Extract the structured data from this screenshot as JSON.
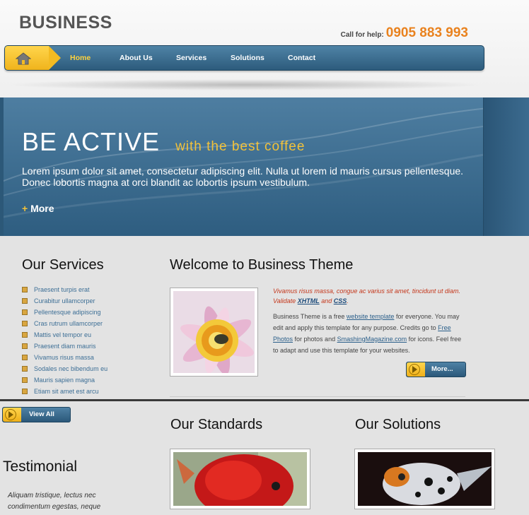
{
  "header": {
    "logo": "BUSINESS",
    "help_label": "Call for help:",
    "phone": "0905 883 993"
  },
  "nav": {
    "items": [
      "Home",
      "About Us",
      "Services",
      "Solutions",
      "Contact"
    ],
    "active": "Home"
  },
  "hero": {
    "title": "BE ACTIVE",
    "subtitle": "with the best coffee",
    "text": "Lorem ipsum dolor sit amet, consectetur adipiscing elit. Nulla ut lorem id mauris cursus pellentesque. Donec lobortis magna at orci blandit ac lobortis ipsum vestibulum.",
    "more_plus": "+",
    "more_label": "More"
  },
  "services": {
    "title": "Our Services",
    "items": [
      "Praesent turpis erat",
      "Curabitur ullamcorper",
      "Pellentesque adipiscing",
      "Cras rutrum ullamcorper",
      "Mattis vel tempor eu",
      "Praesent diam mauris",
      "Vivamus risus massa",
      "Sodales nec bibendum eu",
      "Mauris sapien magna",
      "Etiam sit amet est arcu"
    ],
    "view_all": "View All"
  },
  "welcome": {
    "title": "Welcome to Business Theme",
    "intro_1": "Vivamus risus massa, congue ac varius sit amet, tincidunt ut diam. Validate ",
    "intro_link_1": "XHTML",
    "intro_and": " and ",
    "intro_link_2": "CSS",
    "intro_end": ".",
    "body_1": "Business Theme is a free ",
    "body_link_1": "website template",
    "body_2": " for everyone. You may edit and apply this template for any purpose. Credits go to ",
    "body_link_2": "Free Photos",
    "body_3": " for photos and ",
    "body_link_3": "SmashingMagazine.com",
    "body_4": " for icons. Feel free to adapt and use this template for your websites.",
    "more": "More..."
  },
  "standards": {
    "title": "Our Standards"
  },
  "solutions": {
    "title": "Our Solutions"
  },
  "testimonial": {
    "title": "Testimonial",
    "text": "Aliquam tristique, lectus nec condimentum egestas, neque"
  },
  "colors": {
    "accent": "#e9821e",
    "nav_blue": "#2d5b7c",
    "gold": "#f2c23a"
  }
}
